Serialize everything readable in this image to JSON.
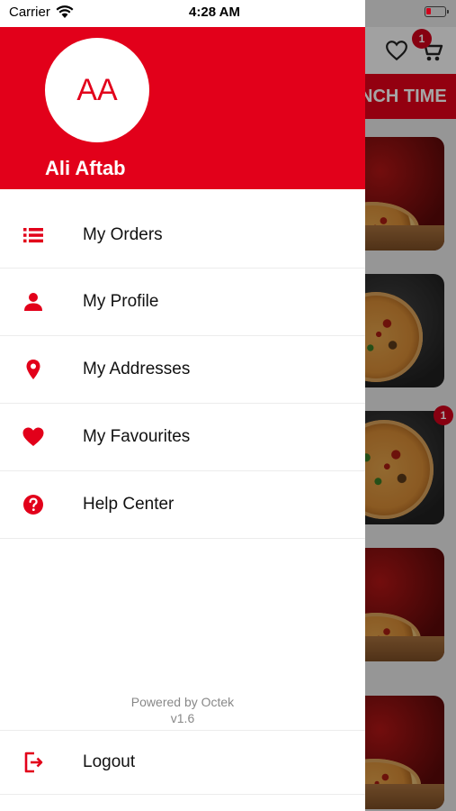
{
  "status_bar": {
    "carrier": "Carrier",
    "time": "4:28 AM"
  },
  "drawer": {
    "avatar_initials": "AA",
    "user_name": "Ali Aftab",
    "menu": [
      {
        "label": "My Orders",
        "icon": "list-icon"
      },
      {
        "label": "My Profile",
        "icon": "person-icon"
      },
      {
        "label": "My Addresses",
        "icon": "location-pin-icon"
      },
      {
        "label": "My Favourites",
        "icon": "heart-icon"
      },
      {
        "label": "Help Center",
        "icon": "help-icon"
      }
    ],
    "powered_by": "Powered by Octek",
    "version": "v1.6",
    "logout_label": "Logout"
  },
  "background": {
    "banner_text": "NCH TIME",
    "cart_count": "1",
    "item_badge": "1"
  },
  "colors": {
    "brand_red": "#e2001a"
  }
}
